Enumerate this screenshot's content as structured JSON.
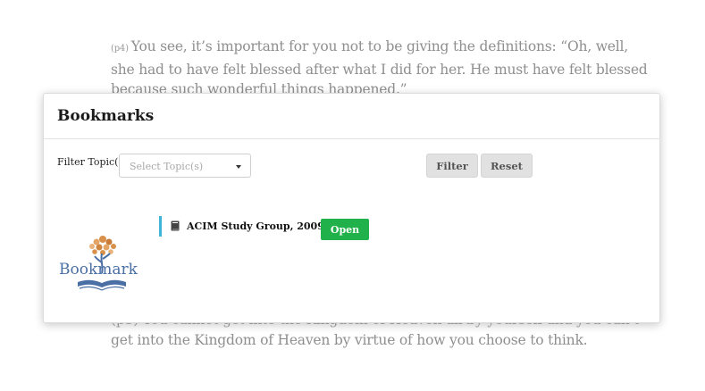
{
  "background": {
    "top_paragraph": {
      "number": "(p4)",
      "line1": "You see, it’s important for you not to be giving the definitions: “Oh, well,",
      "line2": "she had to have felt blessed after what I did for her. He must have felt blessed",
      "line3": "because such wonderful things happened.”"
    },
    "bottom_paragraph": {
      "line1": "(p5) You cannot get into the Kingdom of Heaven all by yourself and you can’t",
      "line2": "get into the Kingdom of Heaven by virtue of how you choose to think."
    }
  },
  "modal": {
    "title": "Bookmarks",
    "filter": {
      "label": "Filter Topic(s)",
      "placeholder": "Select Topic(s)",
      "filter_label": "Filter",
      "reset_label": "Reset"
    },
    "logo": {
      "text": "Bookmark",
      "icon": "tree-book-logo"
    },
    "results": [
      {
        "title": "ACIM Study Group, 2009 (1)",
        "icon": "book-icon",
        "action_label": "Open"
      }
    ]
  },
  "colors": {
    "accent_bar": "#3fb4d9",
    "open_button": "#21b14a",
    "logo_blue": "#4a6fa5",
    "logo_orange": "#d8904a"
  }
}
